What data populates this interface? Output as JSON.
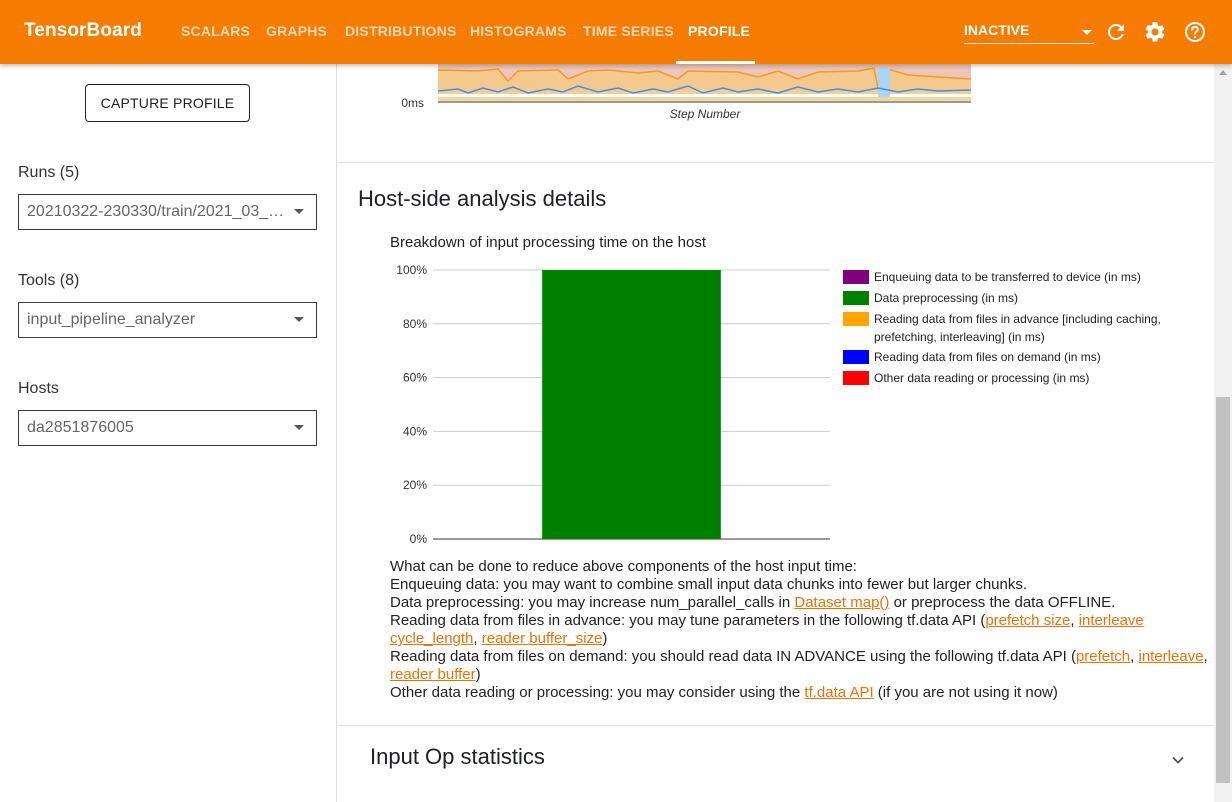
{
  "app": {
    "brand": "TensorBoard",
    "tabs": [
      {
        "label": "SCALARS",
        "active": false
      },
      {
        "label": "GRAPHS",
        "active": false
      },
      {
        "label": "DISTRIBUTIONS",
        "active": false
      },
      {
        "label": "HISTOGRAMS",
        "active": false
      },
      {
        "label": "TIME SERIES",
        "active": false
      },
      {
        "label": "PROFILE",
        "active": true
      }
    ],
    "status": "INACTIVE",
    "icons": [
      "refresh-icon",
      "settings-icon",
      "help-icon"
    ],
    "accent_color": "#f57c00"
  },
  "sidebar": {
    "capture_label": "CAPTURE PROFILE",
    "runs_label": "Runs (5)",
    "runs_value": "20210322-230330/train/2021_03_…",
    "tools_label": "Tools (8)",
    "tools_value": "input_pipeline_analyzer",
    "hosts_label": "Hosts",
    "hosts_value": "da2851876005"
  },
  "step_chart": {
    "y_tick": "0ms",
    "xlabel": "Step Number"
  },
  "host_analysis": {
    "title": "Host-side analysis details",
    "chart_title": "Breakdown of input processing time on the host",
    "advice_heading": "What can be done to reduce above components of the host input time:",
    "advice": {
      "enqueue": "Enqueuing data: you may want to combine small input data chunks into fewer but larger chunks.",
      "preprocess_pre": "Data preprocessing: you may increase num_parallel_calls in ",
      "preprocess_link": "Dataset map()",
      "preprocess_post": " or preprocess the data OFFLINE.",
      "advance_pre": "Reading data from files in advance: you may tune parameters in the following tf.data API (",
      "advance_link1": "prefetch size",
      "advance_link2": "interleave cycle_length",
      "advance_link3": "reader buffer_size",
      "demand_pre": "Reading data from files on demand: you should read data IN ADVANCE using the following tf.data API (",
      "demand_link1": "prefetch",
      "demand_link2": "interleave",
      "demand_link3": "reader buffer",
      "other_pre": "Other data reading or processing: you may consider using the ",
      "other_link": "tf.data API",
      "other_post": " (if you are not using it now)"
    }
  },
  "input_op": {
    "title": "Input Op statistics"
  },
  "chart_data": {
    "type": "bar",
    "title": "Breakdown of input processing time on the host",
    "categories": [
      ""
    ],
    "stacked": true,
    "series": [
      {
        "name": "Enqueuing data to be transferred to device (in ms)",
        "color": "#800080",
        "values": [
          0
        ]
      },
      {
        "name": "Data preprocessing (in ms)",
        "color": "#008000",
        "values": [
          100
        ]
      },
      {
        "name": "Reading data from files in advance [including caching, prefetching, interleaving] (in ms)",
        "color": "#ffa500",
        "values": [
          0
        ]
      },
      {
        "name": "Reading data from files on demand (in ms)",
        "color": "#0000ff",
        "values": [
          0
        ]
      },
      {
        "name": "Other data reading or processing (in ms)",
        "color": "#ff0000",
        "values": [
          0
        ]
      }
    ],
    "yticks": [
      "0%",
      "20%",
      "40%",
      "60%",
      "80%",
      "100%"
    ],
    "ylim": [
      0,
      100
    ],
    "grid": true,
    "legend": "right"
  }
}
